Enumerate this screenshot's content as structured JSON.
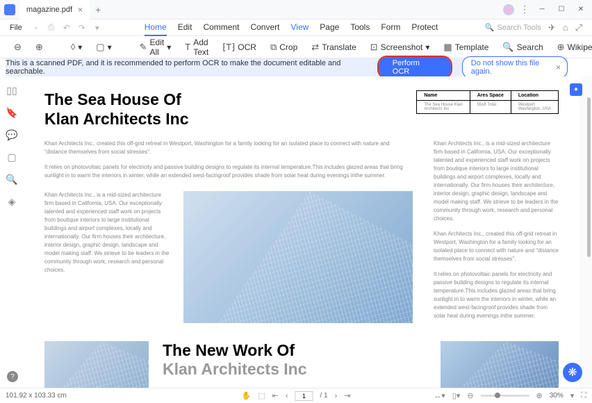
{
  "titlebar": {
    "filename": "magazine.pdf"
  },
  "menubar": {
    "file": "File",
    "tabs": [
      "Home",
      "Edit",
      "Comment",
      "Convert",
      "View",
      "Page",
      "Tools",
      "Form",
      "Protect"
    ],
    "search_placeholder": "Search Tools"
  },
  "toolbar": {
    "edit_all": "Edit All",
    "add_text": "Add Text",
    "ocr": "OCR",
    "crop": "Crop",
    "translate": "Translate",
    "screenshot": "Screenshot",
    "template": "Template",
    "search": "Search",
    "wikipedia": "Wikipedia"
  },
  "banner": {
    "message": "This is a scanned PDF, and it is recommended to perform OCR to make the document editable and searchable.",
    "perform": "Perform OCR",
    "dismiss": "Do not show this file again."
  },
  "doc": {
    "title1": "The Sea House Of",
    "title2": "Klan Architects Inc",
    "table": {
      "h1": "Name",
      "h2": "Ares Space",
      "h3": "Location",
      "v1a": "The Sea House Klan",
      "v1b": "Architects Inc",
      "v2": "55sft Total",
      "v3a": "Westport",
      "v3b": "Washington, USA"
    },
    "p1": "Khan Architects Inc., created this off-grid retreat in Westport, Washington for a family looking for an isolated place to connect with nature and \"distance themselves from social stresses\".",
    "p2": "It relies on photovoltaic panels for electricity and passive building designs to regulate its internal temperature.This includes glazed areas that bring sunlight in to warm the interiors in winter, while an extended west-facingroof provides shade from solar heat during evenings inthe summer.",
    "col1": "Khan Architects Inc., is a mid-sized architecture firm based in California, USA. Our exceptionally talented and experienced staff work on projects from boutique interiors to large institutional buildings and airport complexes, locally and internationally. Our firm houses their architecture, interior design, graphic design, landscape and model making staff. We strieve to be leaders in the community through work, research and personal choices.",
    "col_r1": "Khan Architects Inc., is a mid-sized architecture firm based in California, USA. Our exceptionally talented and experienced staff work on projects from boutique interiors to large institutional buildings and airport complexes, locally and internationally. Our firm houses their architecture, interior design, graphic design, landscape and model making staff. We strieve to be leaders in the community through work, research and personal choices.",
    "col_r2": "Khan Architects Inc., created this off-grid retreat in Westport, Washington for a family looking for an isolated place to connect with nature and \"distance themselves from social stresses\".",
    "col_r3": "It relies on photovoltaic panels for electricity and passive building designs to regulate its internal temperature.This includes glazed areas that bring sunlight in to warm the interiors in winter, while an extended west-facingroof provides shade from solar heat during evenings inthe summer.",
    "title3": "The New Work Of",
    "title4": "Klan Architects Inc"
  },
  "statusbar": {
    "dimensions": "101.92 x 103.33 cm",
    "page_current": "1",
    "page_total": "/ 1",
    "zoom": "30%"
  }
}
